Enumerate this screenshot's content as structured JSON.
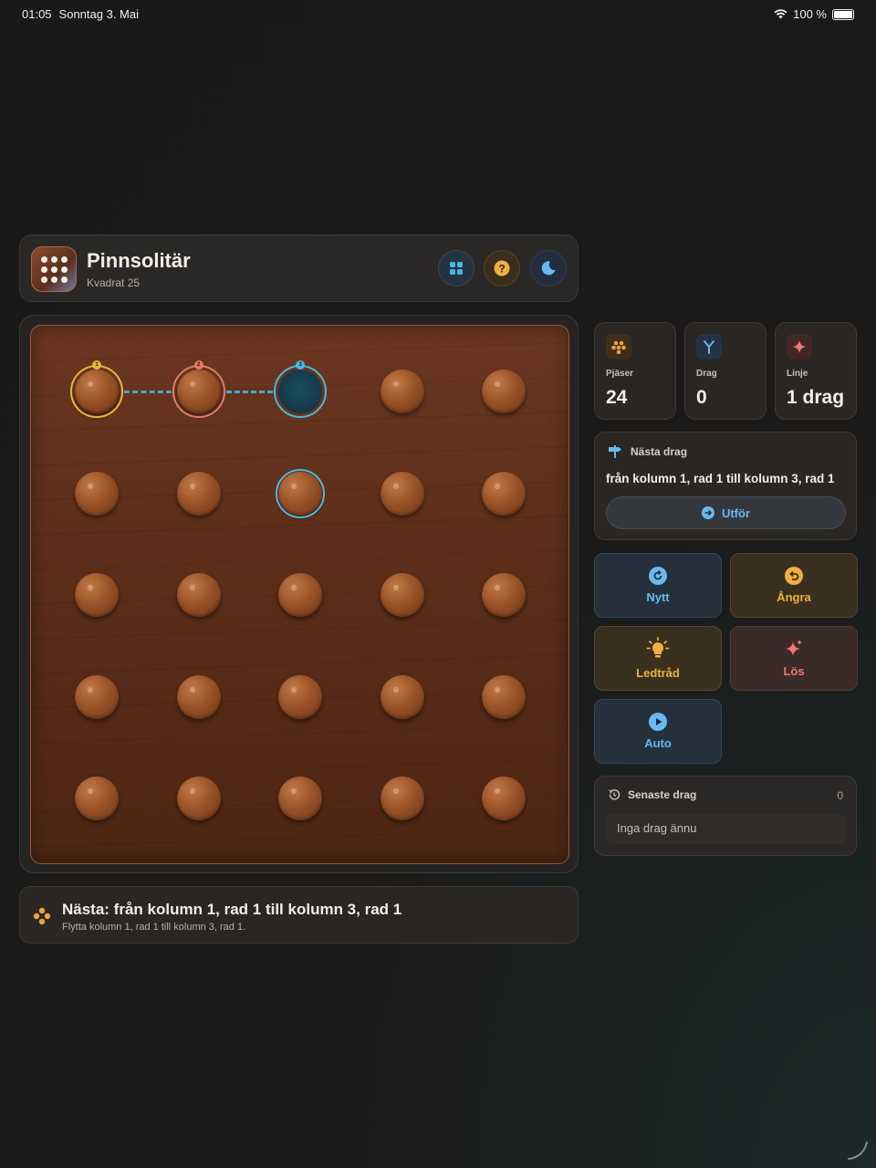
{
  "status": {
    "time": "01:05",
    "date": "Sonntag 3. Mai",
    "battery": "100 %"
  },
  "header": {
    "title": "Pinnsolitär",
    "subtitle": "Kvadrat 25"
  },
  "stats": {
    "pieces": {
      "label": "Pjäser",
      "value": "24"
    },
    "moves": {
      "label": "Drag",
      "value": "0"
    },
    "line": {
      "label": "Linje",
      "value": "1 drag"
    }
  },
  "next": {
    "heading": "Nästa drag",
    "move": "från kolumn 1, rad 1 till kolumn 3, rad 1",
    "execute_label": "Utför"
  },
  "actions": {
    "new": "Nytt",
    "undo": "Ångra",
    "hint": "Ledtråd",
    "solve": "Lös",
    "auto": "Auto"
  },
  "recent": {
    "heading": "Senaste drag",
    "count": "0",
    "empty": "Inga drag ännu"
  },
  "hint_bar": {
    "title": "Nästa: från kolumn 1, rad 1 till kolumn 3, rad 1",
    "subtitle": "Flytta kolumn 1, rad 1 till kolumn 3, rad 1."
  },
  "board": {
    "rows": 5,
    "cols": 5,
    "empty_cells": [
      [
        1,
        3
      ]
    ],
    "path": [
      {
        "cell": [
          1,
          1
        ],
        "badge": "1",
        "color": "#e8b63a"
      },
      {
        "cell": [
          1,
          2
        ],
        "badge": "2",
        "color": "#e47a6a"
      },
      {
        "cell": [
          1,
          3
        ],
        "badge": "3",
        "color": "#4ab8e0"
      }
    ],
    "highlighted": [
      [
        2,
        3
      ]
    ]
  },
  "colors": {
    "accent_blue": "#6ab8f0",
    "accent_orange": "#f0b040",
    "accent_pink": "#f07a6a",
    "wood": "#5a2d18"
  }
}
